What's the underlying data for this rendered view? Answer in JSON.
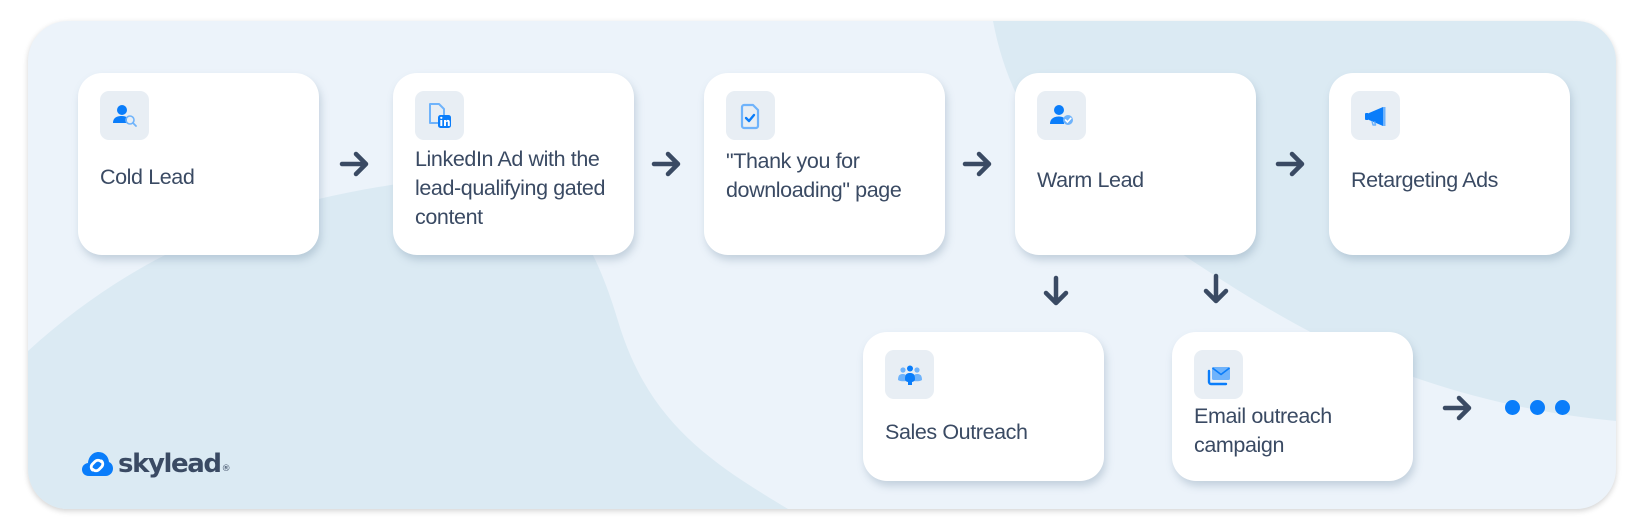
{
  "brand": {
    "name": "skylead",
    "registered_mark": "®",
    "logo_icon": "cloud-link-icon"
  },
  "colors": {
    "accent": "#0a7dfa",
    "accent_light": "#6fb3fb",
    "text": "#3a4a63",
    "arrow": "#3a4a63",
    "background": "#ecf3fa",
    "background_blob": "#dbeaf3",
    "card": "#ffffff",
    "icon_box": "#e8eef4"
  },
  "flow": {
    "steps": [
      {
        "id": "cold-lead",
        "label": "Cold Lead",
        "icon": "user-search-icon"
      },
      {
        "id": "linkedin-ad",
        "label": "LinkedIn Ad with the lead-qualifying gated content",
        "icon": "linkedin-document-icon"
      },
      {
        "id": "thank-you-page",
        "label": "\"Thank you for downloading\" page",
        "icon": "document-check-icon"
      },
      {
        "id": "warm-lead",
        "label": "Warm Lead",
        "icon": "user-verified-icon"
      },
      {
        "id": "retargeting-ads",
        "label": "Retargeting Ads",
        "icon": "megaphone-icon"
      },
      {
        "id": "sales-outreach",
        "label": "Sales Outreach",
        "icon": "team-icon"
      },
      {
        "id": "email-outreach",
        "label": "Email outreach campaign",
        "icon": "envelope-icon"
      }
    ],
    "connections": [
      {
        "from": "cold-lead",
        "to": "linkedin-ad",
        "direction": "right"
      },
      {
        "from": "linkedin-ad",
        "to": "thank-you-page",
        "direction": "right"
      },
      {
        "from": "thank-you-page",
        "to": "warm-lead",
        "direction": "right"
      },
      {
        "from": "warm-lead",
        "to": "retargeting-ads",
        "direction": "right"
      },
      {
        "from": "warm-lead",
        "to": "sales-outreach",
        "direction": "down"
      },
      {
        "from": "warm-lead",
        "to": "email-outreach",
        "direction": "down"
      },
      {
        "from": "email-outreach",
        "to": "more",
        "direction": "right"
      }
    ],
    "continuation": "more-steps-ellipsis"
  }
}
